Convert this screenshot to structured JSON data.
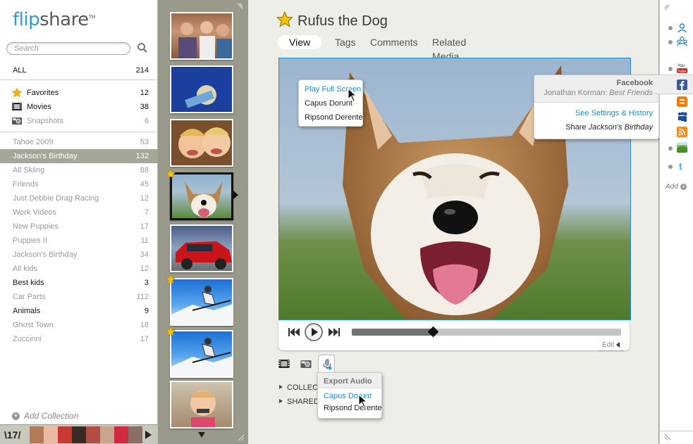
{
  "sidebar": {
    "logo_main": "flip",
    "logo_share": "share",
    "logo_tm": "TM",
    "search_placeholder": "Search",
    "all": {
      "label": "ALL",
      "count": "214"
    },
    "special": [
      {
        "label": "Favorites",
        "count": "12",
        "icon": "star-icon"
      },
      {
        "label": "Movies",
        "count": "38",
        "icon": "film-icon"
      },
      {
        "label": "Snapshots",
        "count": "6",
        "icon": "camera-icon"
      }
    ],
    "collections": [
      {
        "label": "Tahoe 2009",
        "count": "53",
        "style": "grey"
      },
      {
        "label": "Jackson's Birthday",
        "count": "132",
        "style": "selected"
      },
      {
        "label": "All Skiing",
        "count": "88",
        "style": "grey"
      },
      {
        "label": "Friends",
        "count": "45",
        "style": "grey"
      },
      {
        "label": "Just Debbie Drag Racing",
        "count": "12",
        "style": "grey"
      },
      {
        "label": "Work Videos",
        "count": "7",
        "style": "grey"
      },
      {
        "label": "New Puppies",
        "count": "17",
        "style": "grey"
      },
      {
        "label": "Puppies II",
        "count": "11",
        "style": "grey"
      },
      {
        "label": "Jackson's Birthday",
        "count": "34",
        "style": "grey"
      },
      {
        "label": "All kids",
        "count": "12",
        "style": "grey"
      },
      {
        "label": "Best kids",
        "count": "3",
        "style": "normal"
      },
      {
        "label": "Car Parts",
        "count": "112",
        "style": "grey"
      },
      {
        "label": "Animals",
        "count": "9",
        "style": "normal"
      },
      {
        "label": "Ghost Town",
        "count": "18",
        "style": "grey"
      },
      {
        "label": "Zuccinni",
        "count": "17",
        "style": "grey"
      }
    ],
    "add_collection": "Add Collection",
    "strip_logo": "17"
  },
  "main": {
    "title": "Rufus the Dog",
    "tabs": [
      "View",
      "Tags",
      "Comments",
      "Related Media"
    ],
    "active_tab": "View",
    "progress": 0.3,
    "edit_label": "Edit",
    "sections": [
      "COLLECTIONS",
      "SHARED"
    ],
    "sections_visible": [
      "COLLECT",
      "SHARED"
    ]
  },
  "view_menu": {
    "items": [
      "Play Full Screen",
      "Capus Dorunt",
      "Ripsond Derente"
    ]
  },
  "share_popup": {
    "service": "Facebook",
    "user": "Jonathan Korman:",
    "album": "Best Friends",
    "settings_link": "See Settings & History",
    "share_prefix": "Share",
    "share_target": "Jackson's Birthday"
  },
  "audio_menu": {
    "header": "Export Audio",
    "items": [
      "Capus Dorunt",
      "Ripsond Derente"
    ]
  },
  "rightbar": {
    "add_label": "Add",
    "services": [
      "contact-icon",
      "group-icon",
      "youtube-icon",
      "facebook-icon",
      "blogger-icon",
      "myspace-icon",
      "rss-icon",
      "photo-service-icon",
      "twitter-icon"
    ]
  },
  "colors": {
    "accent": "#2f9bd4",
    "selected_row": "#a6a698",
    "link": "#1f8ec8",
    "thumb_bg": "#9a9a8c"
  }
}
